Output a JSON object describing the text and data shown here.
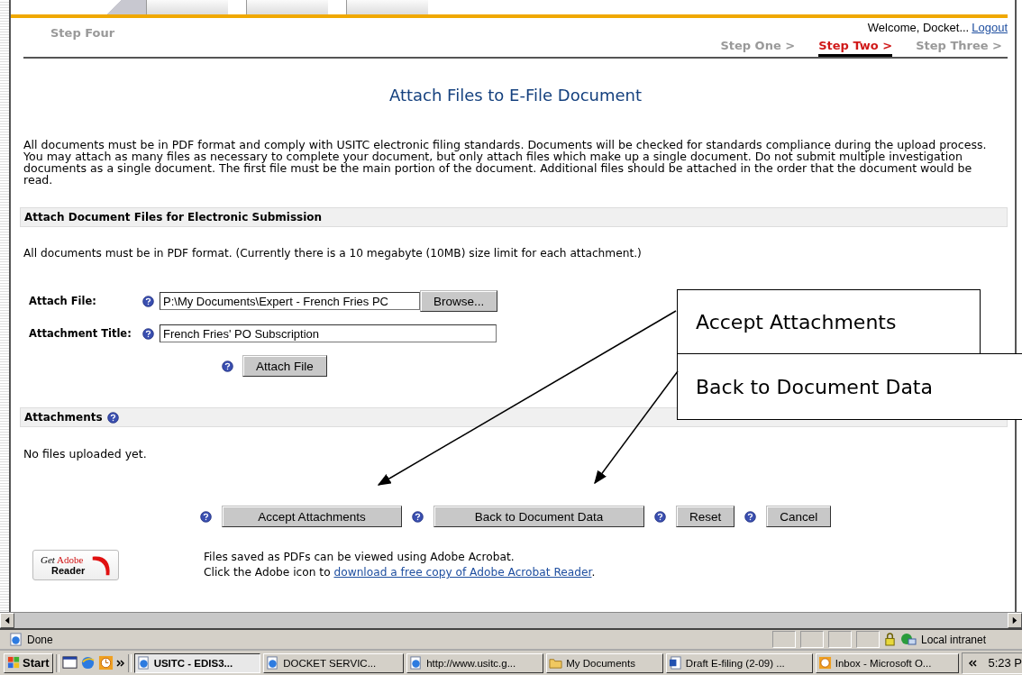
{
  "header": {
    "step_label": "Step Four",
    "welcome": "Welcome, Docket...",
    "logout": "Logout",
    "steps": [
      {
        "label": "Step One >",
        "selected": false
      },
      {
        "label": "Step Two >",
        "selected": true
      },
      {
        "label": "Step Three >",
        "selected": false
      }
    ]
  },
  "title": "Attach Files to E-File Document",
  "intro": "All documents must be in PDF format and comply with USITC electronic filing standards. Documents will be checked for standards compliance during the upload process. You may attach as many files as necessary to complete your document, but only attach files which make up a single document. Do not submit multiple investigation documents as a single document. The first file must be the main portion of the document. Additional files should be attached in the order that the document would be read.",
  "attach_section": {
    "heading": "Attach Document Files for Electronic Submission",
    "note": "All documents must be in PDF format. (Currently there is a 10 megabyte (10MB) size limit for each attachment.)",
    "fields": [
      {
        "label": "Attach File:",
        "value": "P:\\My Documents\\Expert - French Fries PC",
        "button": "Browse..."
      },
      {
        "label": "Attachment Title:",
        "value": "French Fries' PO Subscription"
      }
    ],
    "attach_button": "Attach File"
  },
  "attachments": {
    "heading": "Attachments",
    "empty_message": "No files uploaded yet."
  },
  "actions": [
    "Accept Attachments",
    "Back to Document Data",
    "Reset",
    "Cancel"
  ],
  "adobe": {
    "badge_get": "Get",
    "badge_brand": "Adobe",
    "badge_product": "Reader",
    "line1": "Files saved as PDFs can be viewed using Adobe Acrobat.",
    "line2": "Click the Adobe icon to",
    "link": "download a free copy of Adobe Acrobat Reader",
    "after_link": "."
  },
  "callouts": [
    "Accept Attachments",
    "Back to Document Data"
  ],
  "status_bar": {
    "text": "Done",
    "zone": "Local intranet"
  },
  "taskbar": {
    "start": "Start",
    "tasks": [
      {
        "label": "USITC - EDIS3...",
        "selected": true,
        "kind": "browser"
      },
      {
        "label": "DOCKET SERVIC...",
        "selected": false,
        "kind": "browser"
      },
      {
        "label": "http://www.usitc.g...",
        "selected": false,
        "kind": "browser"
      },
      {
        "label": "My Documents",
        "selected": false,
        "kind": "folder"
      },
      {
        "label": "Draft E-filing (2-09) ...",
        "selected": false,
        "kind": "document"
      },
      {
        "label": "Inbox - Microsoft O...",
        "selected": false,
        "kind": "mail"
      }
    ],
    "clock": "5:23 P"
  }
}
